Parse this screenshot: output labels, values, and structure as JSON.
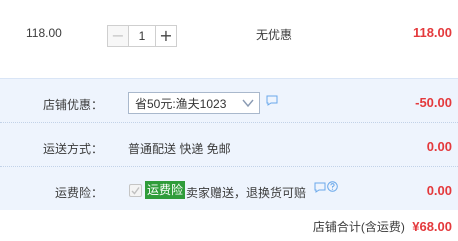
{
  "item": {
    "unit_price": "118.00",
    "quantity": "1",
    "minus_symbol": "−",
    "plus_symbol": "+",
    "promotion": "无优惠",
    "total": "118.00"
  },
  "shop_discount": {
    "label": "店铺优惠：",
    "selected": "省50元:渔夫1023",
    "amount": "-50.00"
  },
  "shipping": {
    "label": "运送方式：",
    "value": "普通配送 快递 免邮",
    "amount": "0.00"
  },
  "insurance": {
    "label": "运费险：",
    "tag": "运费险",
    "desc": "卖家赠送，退换货可赔",
    "amount": "0.00"
  },
  "shop_total": {
    "label": "店铺合计(含运费)",
    "amount": "¥68.00"
  },
  "colors": {
    "price_red": "#e4393c",
    "panel_bg": "#eef4fd",
    "tag_green": "#2f9c3a",
    "icon_blue": "#6aa8ea"
  }
}
